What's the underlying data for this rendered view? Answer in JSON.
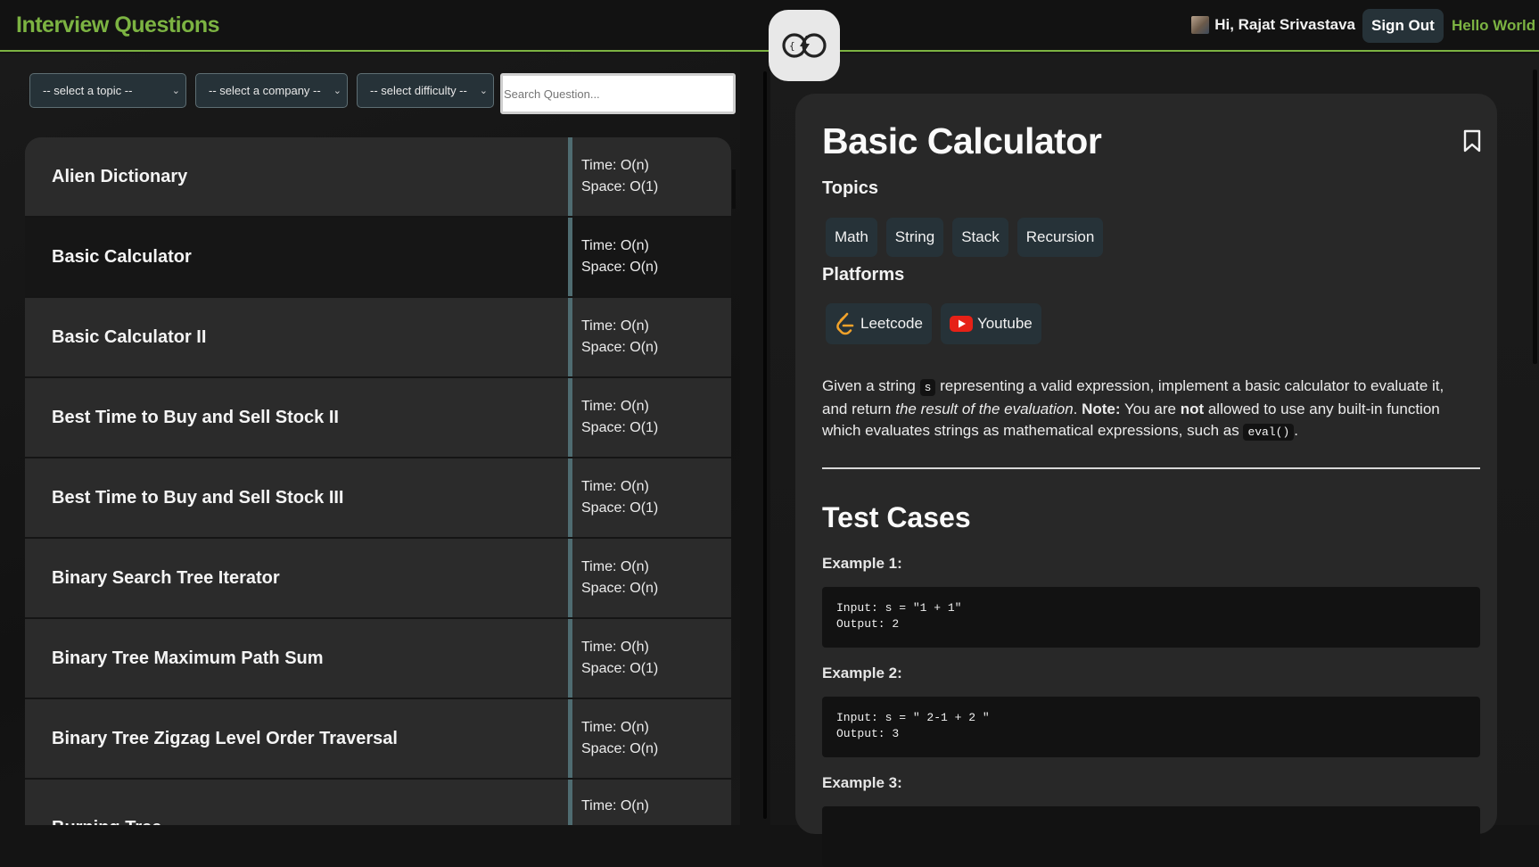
{
  "header": {
    "brand": "Interview Questions",
    "user_greeting": "Hi, Rajat Srivastava",
    "sign_out_label": "Sign Out",
    "hello_link": "Hello World",
    "logo_icon": "logo-icon"
  },
  "filters": {
    "topic": "-- select a topic --",
    "company": "-- select a company --",
    "difficulty": "-- select difficulty --",
    "search_placeholder": "Search Question..."
  },
  "questions": [
    {
      "name": "Alien Dictionary",
      "time": "Time: O(n)",
      "space": "Space: O(1)"
    },
    {
      "name": "Basic Calculator",
      "time": "Time: O(n)",
      "space": "Space: O(n)"
    },
    {
      "name": "Basic Calculator II",
      "time": "Time: O(n)",
      "space": "Space: O(n)"
    },
    {
      "name": "Best Time to Buy and Sell Stock II",
      "time": "Time: O(n)",
      "space": "Space: O(1)"
    },
    {
      "name": "Best Time to Buy and Sell Stock III",
      "time": "Time: O(n)",
      "space": "Space: O(1)"
    },
    {
      "name": "Binary Search Tree Iterator",
      "time": "Time: O(n)",
      "space": "Space: O(n)"
    },
    {
      "name": "Binary Tree Maximum Path Sum",
      "time": "Time: O(h)",
      "space": "Space: O(1)"
    },
    {
      "name": "Binary Tree Zigzag Level Order Traversal",
      "time": "Time: O(n)",
      "space": "Space: O(n)"
    },
    {
      "name": "Burning Tree",
      "time": "Time: O(n)",
      "space": ""
    }
  ],
  "detail": {
    "title": "Basic Calculator",
    "topics_heading": "Topics",
    "topics": [
      "Math",
      "String",
      "Stack",
      "Recursion"
    ],
    "platforms_heading": "Platforms",
    "platforms": [
      {
        "label": "Leetcode",
        "icon": "leetcode-icon"
      },
      {
        "label": "Youtube",
        "icon": "youtube-icon"
      }
    ],
    "description": {
      "p1": "Given a string ",
      "code1": "s",
      "p2": " representing a valid expression, implement a basic calculator to evaluate it, and return ",
      "em": "the result of the evaluation",
      "p3": ". ",
      "note_label": "Note:",
      "p4": " You are ",
      "not": "not",
      "p5": " allowed to use any built-in function which evaluates strings as mathematical expressions, such as ",
      "code2": "eval()",
      "p6": "."
    },
    "test_cases_heading": "Test Cases",
    "examples": [
      {
        "label": "Example 1:",
        "input": "Input: s = \"1 + 1\"",
        "output": "Output: 2"
      },
      {
        "label": "Example 2:",
        "input": "Input: s = \" 2-1 + 2 \"",
        "output": "Output: 3"
      },
      {
        "label": "Example 3:",
        "input": "",
        "output": ""
      }
    ]
  },
  "colors": {
    "accent": "#7cb342",
    "chip_bg": "#263238",
    "card_bg": "#282828"
  }
}
